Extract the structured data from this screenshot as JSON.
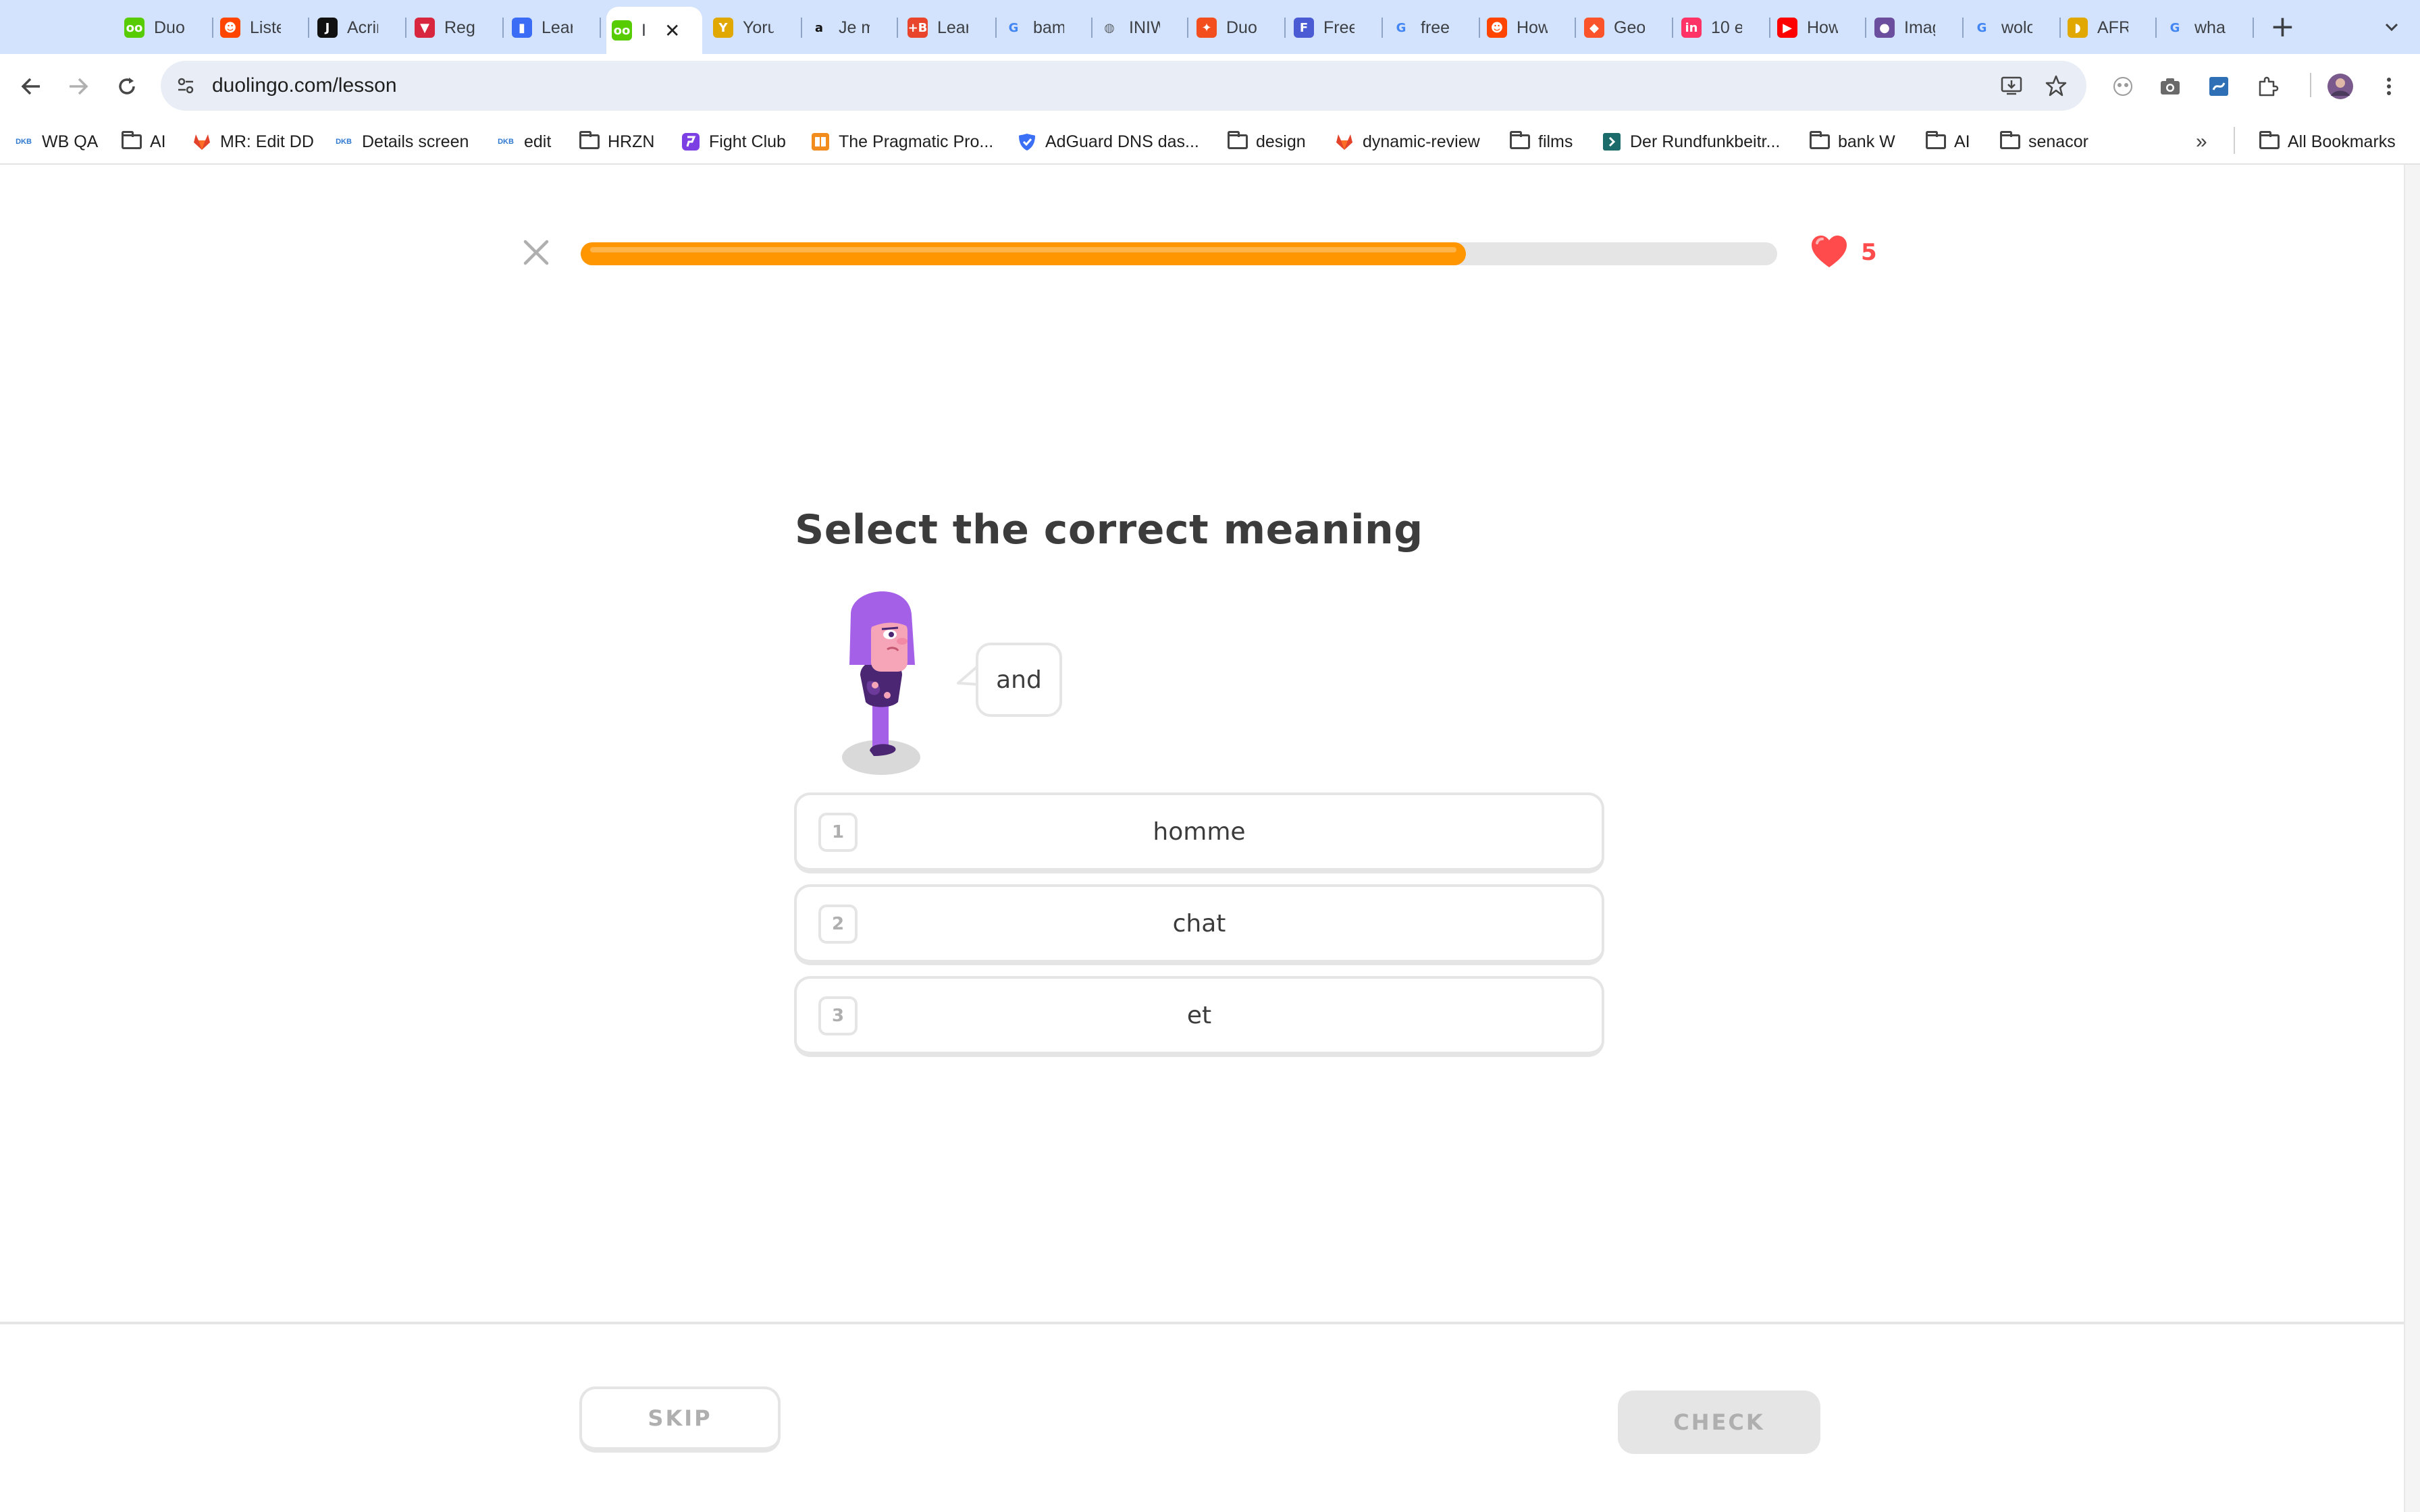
{
  "browser": {
    "tabs": [
      {
        "label": "Duol",
        "icon": "duolingo-icon",
        "color": "#58cc02"
      },
      {
        "label": "Liste",
        "icon": "reddit-icon",
        "color": "#ff4500"
      },
      {
        "label": "Acrir",
        "icon": "j-icon",
        "color": "#111111"
      },
      {
        "label": "Rega",
        "icon": "vivaldi-icon",
        "color": "#d7263d"
      },
      {
        "label": "Lear",
        "icon": "bookmark-icon",
        "color": "#3b6cf6"
      },
      {
        "label": "I",
        "icon": "duolingo-icon",
        "color": "#58cc02",
        "active": true
      },
      {
        "label": "Yoru",
        "icon": "yoru-icon",
        "color": "#e0a800"
      },
      {
        "label": "Je m",
        "icon": "amazon-icon",
        "color": "#111111"
      },
      {
        "label": "Lear",
        "icon": "plus-b-icon",
        "color": "#e8452c"
      },
      {
        "label": "bam",
        "icon": "google-icon",
        "color": "#4285f4"
      },
      {
        "label": "INIW",
        "icon": "globe-icon",
        "color": "#5f6368"
      },
      {
        "label": "Duol",
        "icon": "figma-icon",
        "color": "#f24e1e"
      },
      {
        "label": "Free",
        "icon": "form-icon",
        "color": "#4a5bd4"
      },
      {
        "label": "free",
        "icon": "google-icon",
        "color": "#4285f4"
      },
      {
        "label": "How",
        "icon": "reddit-icon",
        "color": "#ff4500"
      },
      {
        "label": "Geo",
        "icon": "brave-icon",
        "color": "#fb542b"
      },
      {
        "label": "10 e",
        "icon": "invision-icon",
        "color": "#ff3366"
      },
      {
        "label": "How",
        "icon": "youtube-icon",
        "color": "#ff0000"
      },
      {
        "label": "Imag",
        "icon": "avatar-icon",
        "color": "#6b4f9e"
      },
      {
        "label": "wolo",
        "icon": "google-icon",
        "color": "#4285f4"
      },
      {
        "label": "AFR",
        "icon": "africa-icon",
        "color": "#e0a800"
      },
      {
        "label": "wha",
        "icon": "google-icon",
        "color": "#4285f4"
      }
    ],
    "new_tab": "+",
    "url": "duolingo.com/lesson",
    "bookmarks": [
      {
        "label": "WB QA",
        "icon": "dkb-icon"
      },
      {
        "label": "AI",
        "icon": "folder-icon"
      },
      {
        "label": "MR: Edit DD",
        "icon": "gitlab-icon"
      },
      {
        "label": "Details screen",
        "icon": "dkb-icon"
      },
      {
        "label": "edit",
        "icon": "dkb-icon"
      },
      {
        "label": "HRZN",
        "icon": "folder-icon"
      },
      {
        "label": "Fight Club",
        "icon": "fightclub-icon"
      },
      {
        "label": "The Pragmatic Pro...",
        "icon": "book-icon"
      },
      {
        "label": "AdGuard DNS das...",
        "icon": "adguard-icon"
      },
      {
        "label": "design",
        "icon": "folder-icon"
      },
      {
        "label": "dynamic-review",
        "icon": "gitlab-icon"
      },
      {
        "label": "films",
        "icon": "folder-icon"
      },
      {
        "label": "Der Rundfunkbeitr...",
        "icon": "rundfunk-icon"
      },
      {
        "label": "bank W",
        "icon": "folder-icon"
      },
      {
        "label": "AI",
        "icon": "folder-icon"
      },
      {
        "label": "senacor",
        "icon": "folder-icon"
      }
    ],
    "more_bookmarks": "»",
    "all_bookmarks": "All Bookmarks"
  },
  "lesson": {
    "progress": 0.74,
    "progress_color": "#ff9600",
    "hearts": "5",
    "heart_color": "#ff4b4b",
    "title": "Select the correct meaning",
    "speech": "and",
    "choices": [
      {
        "num": "1",
        "label": "homme"
      },
      {
        "num": "2",
        "label": "chat"
      },
      {
        "num": "3",
        "label": "et"
      }
    ],
    "skip_label": "SKIP",
    "check_label": "CHECK"
  }
}
